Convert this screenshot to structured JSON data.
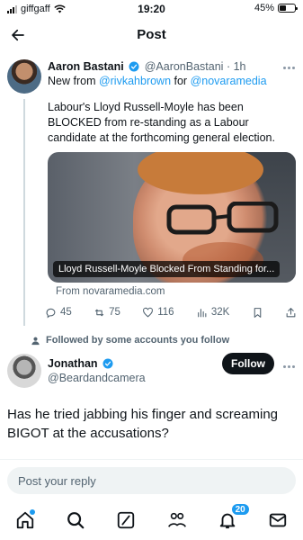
{
  "status_bar": {
    "carrier": "giffgaff",
    "time": "19:20",
    "battery": "45%",
    "battery_level": 0.45
  },
  "header": {
    "title": "Post"
  },
  "main_tweet": {
    "author_name": "Aaron Bastani",
    "author_handle": "@AaronBastani",
    "separator": "·",
    "time": "1h",
    "new_from_prefix": "New from ",
    "new_from_user": "@rivkahbrown",
    "new_from_mid": " for ",
    "new_from_org": "@novaramedia",
    "text": "Labour's Lloyd Russell-Moyle has been BLOCKED from re-standing as a Labour candidate at the forthcoming general election.",
    "card_title": "Lloyd Russell-Moyle Blocked From Standing for...",
    "source": "From novaramedia.com",
    "replies": "45",
    "reposts": "75",
    "likes": "116",
    "views": "32K"
  },
  "social_context": "Followed by some accounts you follow",
  "reply": {
    "author_name": "Jonathan",
    "author_handle": "@Beardandcamera",
    "follow_label": "Follow",
    "text": "Has he tried jabbing his finger and screaming BIGOT at the accusations?"
  },
  "composer": {
    "placeholder": "Post your reply"
  },
  "nav": {
    "notifications_count": "20"
  },
  "colors": {
    "accent": "#1d9bf0",
    "text": "#0f1419",
    "muted": "#536471"
  }
}
